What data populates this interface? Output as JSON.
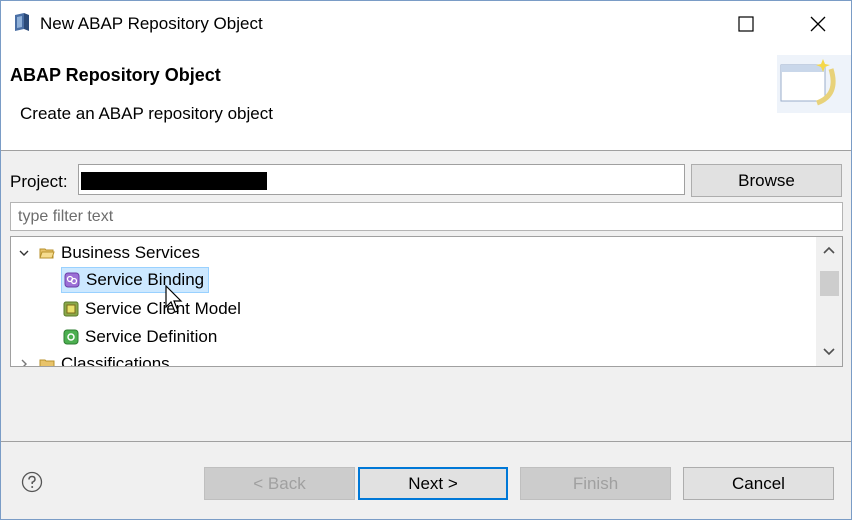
{
  "window": {
    "title": "New ABAP Repository Object",
    "icon": "abap-object-icon"
  },
  "header": {
    "title": "ABAP Repository Object",
    "subtitle": "Create an ABAP repository object"
  },
  "project": {
    "label": "Project:",
    "value_redacted": true,
    "browse_label": "Browse"
  },
  "filter": {
    "placeholder": "type filter text",
    "value": ""
  },
  "tree": {
    "items": [
      {
        "label": "Business Services",
        "level": 0,
        "expanded": true,
        "icon": "folder-open-icon"
      },
      {
        "label": "Service Binding",
        "level": 1,
        "selected": true,
        "icon": "service-binding-icon"
      },
      {
        "label": "Service Client Model",
        "level": 1,
        "icon": "service-client-model-icon"
      },
      {
        "label": "Service Definition",
        "level": 1,
        "icon": "service-definition-icon"
      },
      {
        "label": "Classifications",
        "level": 0,
        "expanded": false,
        "icon": "folder-icon"
      }
    ]
  },
  "buttons": {
    "back": "< Back",
    "next": "Next >",
    "finish": "Finish",
    "cancel": "Cancel"
  },
  "colors": {
    "selection": "#cce8ff",
    "default_button_border": "#0078d7"
  }
}
